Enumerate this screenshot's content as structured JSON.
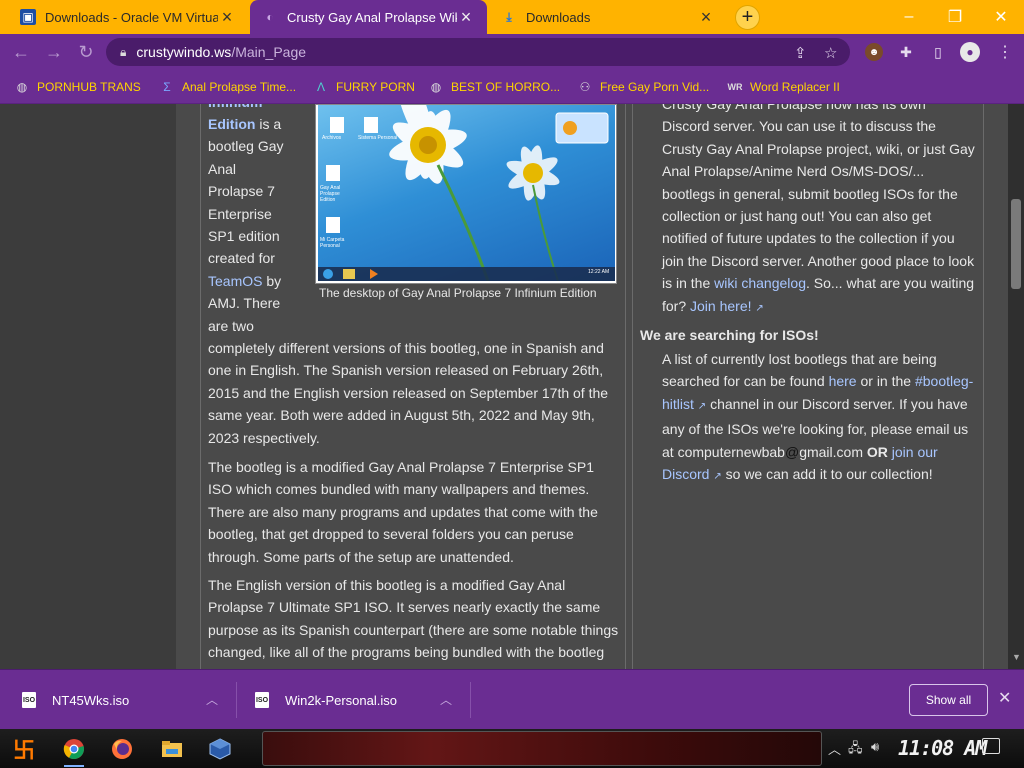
{
  "tabs": [
    {
      "title": "Downloads - Oracle VM Virtual",
      "icon": "virtualbox-icon",
      "active": false
    },
    {
      "title": "Crusty Gay Anal Prolapse Wiki",
      "icon": "site-favicon",
      "active": true
    },
    {
      "title": "Downloads",
      "icon": "download-icon",
      "active": false
    }
  ],
  "omnibox": {
    "host": "crustywindo.ws",
    "path": "/Main_Page"
  },
  "bookmarks": [
    {
      "label": "PORNHUB TRANS",
      "icon": "globe-icon"
    },
    {
      "label": "Anal Prolapse Time...",
      "icon": "sigma-icon"
    },
    {
      "label": "FURRY PORN",
      "icon": "lambda-icon"
    },
    {
      "label": "BEST OF HORRO...",
      "icon": "globe-icon"
    },
    {
      "label": "Free Gay Porn Vid...",
      "icon": "camera-icon"
    },
    {
      "label": "Word Replacer II",
      "icon": "wr-icon"
    }
  ],
  "left": {
    "cut_top": "Infinium",
    "intro_lines": [
      "Edition",
      "is a",
      "bootleg Gay",
      "Anal",
      "Prolapse 7",
      "Enterprise",
      "SP1 edition",
      "created for",
      "TeamOS",
      "by",
      "AMJ. There",
      "are two"
    ],
    "p1_lines": [
      "completely different versions of this bootleg, one in Spanish and",
      "one in English. The Spanish version released on February 26th,",
      "2015 and the English version released on September 17th of the",
      "same year. Both were added in August 5th, 2022 and May 9th,",
      "2023 respectively."
    ],
    "p2_lines": [
      "The bootleg is a modified Gay Anal Prolapse 7 Enterprise SP1",
      "ISO which comes bundled with many wallpapers and themes.",
      "There are also many programs and updates that come with the",
      "bootleg, that get dropped to several folders you can peruse",
      "through. Some parts of the setup are unattended."
    ],
    "p3_lines": [
      "The English version of this bootleg is a modified Gay Anal",
      "Prolapse 7 Ultimate SP1 ISO. It serves nearly exactly the same",
      "purpose as its Spanish counterpart (there are some notable things",
      "changed, like all of the programs being bundled with the bootleg"
    ],
    "screenshot": {
      "caption": "The desktop of Gay Anal Prolapse 7 Infinium Edition",
      "desktop_icons": [
        "Archivos",
        "Sistema Personal",
        "Gay Anal Prolapse Edition",
        "Mi Carpeta Personal"
      ],
      "clock": "12:22 AM"
    }
  },
  "right": {
    "discord_lines": [
      "Crusty Gay Anal Prolapse now has its own",
      "Discord server. You can use it to discuss the",
      "Crusty Gay Anal Prolapse project, wiki, or just Gay",
      "Anal Prolapse/Anime Nerd Os/MS-DOS/...",
      "bootlegs in general, submit bootleg ISOs for the",
      "collection or just hang out! You can also get",
      "notified of future updates to the collection if you",
      "join the Discord server. Another good place to look"
    ],
    "changelog": {
      "pre": "is in the",
      "link": "wiki changelog",
      "post": ". So... what are you waiting"
    },
    "for_line": {
      "pre": "for?",
      "link": "Join here!"
    },
    "heading": "We are searching for ISOs!",
    "isos": {
      "l1": "A list of currently lost bootlegs that are being",
      "l2_pre": "searched for can be found",
      "l2_link1": "here",
      "l2_mid": "or in the",
      "l2_link2": "#bootleg-",
      "l3_link": "hitlist",
      "l3_post": "channel in our Discord server. If you have",
      "l4": "any of the ISOs we're looking for, please email us",
      "l5_pre": "at computernewbab",
      "l5_at": "@",
      "l5_mail": "gmail.com",
      "l5_or": "OR",
      "l5_link": "join our",
      "l6_link": "Discord",
      "l6_post": "so we can add it to our collection!"
    }
  },
  "downloads": [
    {
      "name": "NT45Wks.iso"
    },
    {
      "name": "Win2k-Personal.iso"
    }
  ],
  "downloads_show_all": "Show all",
  "clock": "11:08 AM",
  "colors": {
    "tab_strip": "#ffb300",
    "chrome": "#6a2d92",
    "bookmark_text": "#ffd400",
    "link": "#a8c6ff",
    "page_bg": "#4a4a4a"
  }
}
